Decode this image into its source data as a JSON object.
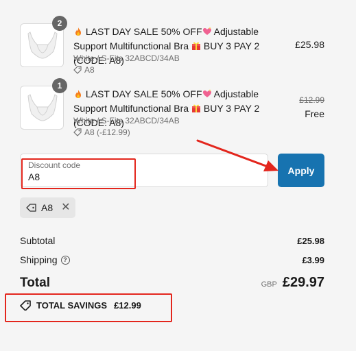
{
  "cart": {
    "items": [
      {
        "quantity": "2",
        "title_a": "LAST DAY SALE 50% OFF",
        "title_b": "Adjustable Support Multifunctional Bra",
        "title_c": "BUY 3 PAY 2 (CODE: A8)",
        "variant": "White / S-Fits 32ABCD/34AB",
        "discount_tag": "A8",
        "price": "£25.98"
      },
      {
        "quantity": "1",
        "title_a": "LAST DAY SALE 50% OFF",
        "title_b": "Adjustable Support Multifunctional Bra",
        "title_c": "BUY 3 PAY 2 (CODE: A8)",
        "variant": "White / S-Fits 32ABCD/34AB",
        "discount_tag": "A8 (-£12.99)",
        "original_price": "£12.99",
        "price": "Free"
      }
    ]
  },
  "discount": {
    "label": "Discount code",
    "value": "A8",
    "apply_label": "Apply",
    "applied_code": "A8"
  },
  "summary": {
    "subtotal_label": "Subtotal",
    "subtotal_value": "£25.98",
    "shipping_label": "Shipping",
    "shipping_value": "£3.99",
    "total_label": "Total",
    "currency": "GBP",
    "total_value": "£29.97",
    "savings_label": "TOTAL SAVINGS",
    "savings_value": "£12.99"
  },
  "icons": {
    "fire": "fire-emoji",
    "heart": "sparkling-heart-emoji",
    "gift": "gift-emoji",
    "tag": "tag-icon",
    "help": "question-circle-icon",
    "remove": "close-icon"
  },
  "colors": {
    "accent": "#1773b0",
    "annotation": "#e3261d"
  }
}
